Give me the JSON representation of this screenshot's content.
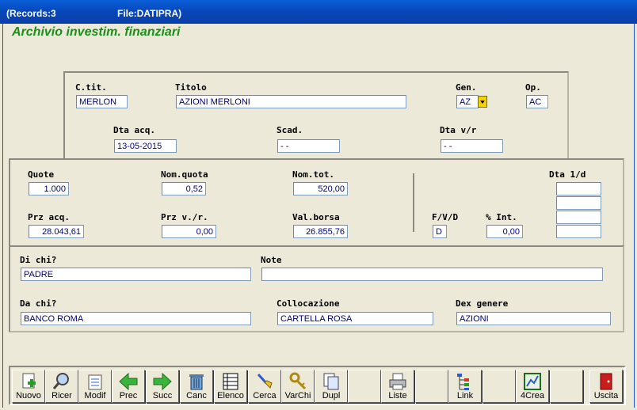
{
  "titlebar": {
    "records": "(Records:3",
    "file": "File:DATIPRA)"
  },
  "app_title": "Archivio investim. finanziari",
  "labels": {
    "ctit": "C.tit.",
    "titolo": "Titolo",
    "gen": "Gen.",
    "op": "Op.",
    "dta_acq": "Dta acq.",
    "scad": "Scad.",
    "dta_vr": "Dta v/r",
    "quote": "Quote",
    "nom_quota": "Nom.quota",
    "nom_tot": "Nom.tot.",
    "dta_1d": "Dta 1/d",
    "prz_acq": "Prz acq.",
    "prz_vr": "Prz v./r.",
    "val_borsa": "Val.borsa",
    "fvd": "F/V/D",
    "pct_int": "% Int.",
    "di_chi": "Di chi?",
    "note": "Note",
    "da_chi": "Da chi?",
    "collocazione": "Collocazione",
    "dex_genere": "Dex genere"
  },
  "fields": {
    "ctit": "MERLON",
    "titolo": "AZIONI MERLONI",
    "gen": "AZ",
    "op": "AC",
    "dta_acq": "13-05-2015",
    "scad": "  -   -",
    "dta_vr": "  -   -",
    "quote": "1.000",
    "nom_quota": "0,52",
    "nom_tot": "520,00",
    "prz_acq": "28.043,61",
    "prz_vr": "0,00",
    "val_borsa": "26.855,76",
    "fvd": "D",
    "pct_int": "0,00",
    "dta_1d": [
      "",
      "",
      "",
      ""
    ],
    "di_chi": "PADRE",
    "note": "",
    "da_chi": "BANCO ROMA",
    "collocazione": "CARTELLA ROSA",
    "dex_genere": "AZIONI"
  },
  "toolbar": [
    {
      "label": "Nuovo",
      "icon": "new-doc-icon"
    },
    {
      "label": "Ricer",
      "icon": "magnifier-icon"
    },
    {
      "label": "Modif",
      "icon": "edit-doc-icon"
    },
    {
      "label": "Prec",
      "icon": "arrow-left-icon"
    },
    {
      "label": "Succ",
      "icon": "arrow-right-icon"
    },
    {
      "label": "Canc",
      "icon": "trash-icon"
    },
    {
      "label": "Elenco",
      "icon": "list-icon"
    },
    {
      "label": "Cerca",
      "icon": "brush-icon"
    },
    {
      "label": "VarChi",
      "icon": "keys-icon"
    },
    {
      "label": "Dupl",
      "icon": "copy-icon"
    },
    {
      "label": "",
      "icon": ""
    },
    {
      "label": "Liste",
      "icon": "printer-icon"
    },
    {
      "label": "",
      "icon": ""
    },
    {
      "label": "Link",
      "icon": "tree-icon"
    },
    {
      "label": "",
      "icon": ""
    },
    {
      "label": "4Crea",
      "icon": "chart-icon"
    },
    {
      "label": "",
      "icon": ""
    },
    {
      "label": "Uscita",
      "icon": "exit-door-icon"
    }
  ],
  "colors": {
    "title_bar": "#0846b8",
    "app_title": "#1a8f1a",
    "field_text": "#000080",
    "background": "#ece9d8"
  }
}
